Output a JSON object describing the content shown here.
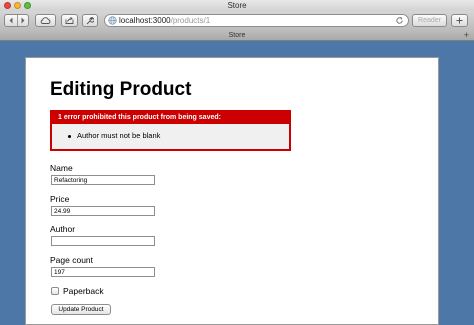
{
  "window": {
    "title": "Store"
  },
  "toolbar": {
    "back_icon": "chevron-left-icon",
    "forward_icon": "chevron-right-icon",
    "cloud_icon": "cloud-icon",
    "share_icon": "share-icon",
    "wrench_icon": "wrench-icon",
    "address": {
      "host": "localhost:3000",
      "path": "/products/1"
    },
    "reader_label": "Reader"
  },
  "tabbar": {
    "title": "Store",
    "add_symbol": "+"
  },
  "page": {
    "title": "Editing Product",
    "error": {
      "heading": "1 error prohibited this product from being saved:",
      "messages": [
        "Author must not be blank"
      ]
    },
    "form": {
      "name_label": "Name",
      "name_value": "Refactoring",
      "price_label": "Price",
      "price_value": "24.99",
      "author_label": "Author",
      "author_value": "",
      "page_count_label": "Page count",
      "page_count_value": "197",
      "paperback_label": "Paperback",
      "paperback_checked": false,
      "submit_label": "Update Product"
    }
  },
  "colors": {
    "error_red": "#cc0000",
    "desktop_blue": "#4d77a6"
  }
}
